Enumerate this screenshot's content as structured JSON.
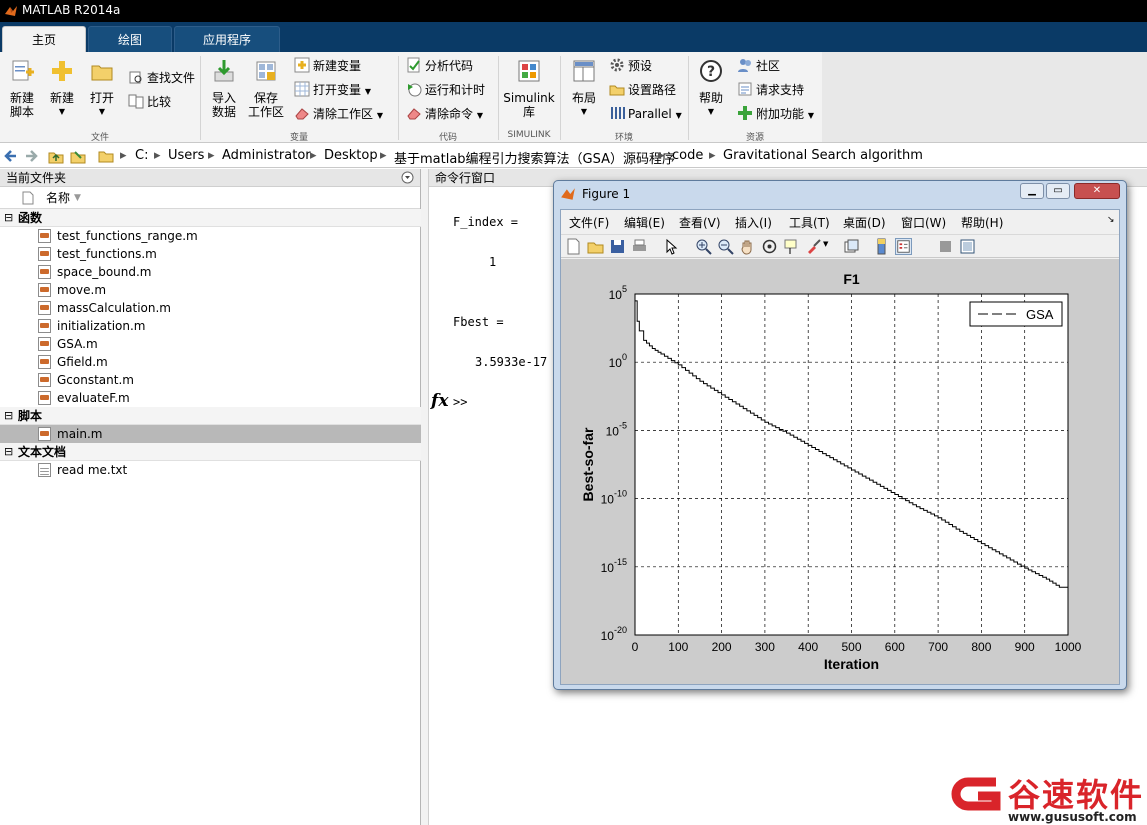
{
  "app": {
    "title": "MATLAB R2014a"
  },
  "tabs": [
    {
      "label": "主页"
    },
    {
      "label": "绘图"
    },
    {
      "label": "应用程序"
    }
  ],
  "ribbon": {
    "new_script": "新建\n脚本",
    "new": "新建",
    "open": "打开",
    "find_files": "查找文件",
    "compare": "比较",
    "import_data": "导入\n数据",
    "save_workspace": "保存\n工作区",
    "new_variable": "新建变量",
    "open_variable": "打开变量",
    "clear_workspace": "清除工作区",
    "analyze_code": "分析代码",
    "run_and_time": "运行和计时",
    "clear_commands": "清除命令",
    "simulink": "Simulink\n库",
    "layout": "布局",
    "preferences": "预设",
    "set_path": "设置路径",
    "parallel": "Parallel",
    "help": "帮助",
    "community": "社区",
    "request_support": "请求支持",
    "addons": "附加功能",
    "groups": {
      "file": "文件",
      "variable": "变量",
      "code": "代码",
      "simulink": "SIMULINK",
      "environment": "环境",
      "resources": "资源"
    }
  },
  "address": {
    "path": [
      "C:",
      "Users",
      "Administrator",
      "Desktop",
      "基于matlab编程引力搜索算法（GSA）源码程序",
      "code",
      "Gravitational Search algorithm"
    ]
  },
  "current_folder": {
    "title": "当前文件夹",
    "column_name": "名称",
    "sections": [
      {
        "label": "函数",
        "files": [
          "test_functions_range.m",
          "test_functions.m",
          "space_bound.m",
          "move.m",
          "massCalculation.m",
          "initialization.m",
          "GSA.m",
          "Gfield.m",
          "Gconstant.m",
          "evaluateF.m"
        ]
      },
      {
        "label": "脚本",
        "files": [
          "main.m"
        ]
      },
      {
        "label": "文本文档",
        "files": [
          "read me.txt"
        ]
      }
    ]
  },
  "command_window": {
    "title": "命令行窗口",
    "line1": "F_index =",
    "line2": "1",
    "line3": "Fbest =",
    "line4": "3.5933e-17",
    "fx": "fx",
    "prompt": ">>"
  },
  "figure": {
    "title": "Figure 1",
    "menu": [
      "文件(F)",
      "编辑(E)",
      "查看(V)",
      "插入(I)",
      "工具(T)",
      "桌面(D)",
      "窗口(W)",
      "帮助(H)"
    ],
    "toolbar_icons": [
      "new-figure-icon",
      "open-icon",
      "save-icon",
      "print-icon",
      "pointer-icon",
      "zoom-in-icon",
      "zoom-out-icon",
      "pan-icon",
      "rotate-icon",
      "data-cursor-icon",
      "brush-icon",
      "link-icon",
      "colorbar-icon",
      "legend-icon",
      "hide-plot-tools-icon",
      "show-plot-tools-icon"
    ]
  },
  "chart_data": {
    "type": "line",
    "title": "F1",
    "xlabel": "Iteration",
    "ylabel": "Best-so-far",
    "xlim": [
      0,
      1000
    ],
    "ylim_log10": [
      -20,
      5
    ],
    "yscale": "log",
    "grid": true,
    "legend": {
      "placement": "top-right",
      "entries": [
        "GSA"
      ]
    },
    "xticks": [
      "0",
      "100",
      "200",
      "300",
      "400",
      "500",
      "600",
      "700",
      "800",
      "900",
      "1000"
    ],
    "ytick_exponents": [
      "5",
      "0",
      "-5",
      "-10",
      "-15",
      "-20"
    ],
    "series": [
      {
        "name": "GSA",
        "x": [
          0,
          5,
          10,
          20,
          40,
          60,
          100,
          150,
          200,
          250,
          300,
          350,
          400,
          450,
          500,
          550,
          600,
          650,
          700,
          750,
          800,
          850,
          900,
          950,
          980,
          1000
        ],
        "y_log10": [
          4.5,
          3.0,
          2.3,
          1.6,
          1.0,
          0.6,
          -0.2,
          -1.4,
          -2.4,
          -3.4,
          -4.4,
          -5.2,
          -6.1,
          -7.0,
          -7.9,
          -8.8,
          -9.7,
          -10.6,
          -11.4,
          -12.4,
          -13.3,
          -14.2,
          -15.1,
          -15.9,
          -16.5,
          -16.5
        ]
      }
    ]
  },
  "watermark": {
    "brand": "谷速软件",
    "url": "www.gususoft.com"
  },
  "colors": {
    "accent": "#0a3a66",
    "selection": "#b8b8b8",
    "watermark": "#d9242a"
  }
}
